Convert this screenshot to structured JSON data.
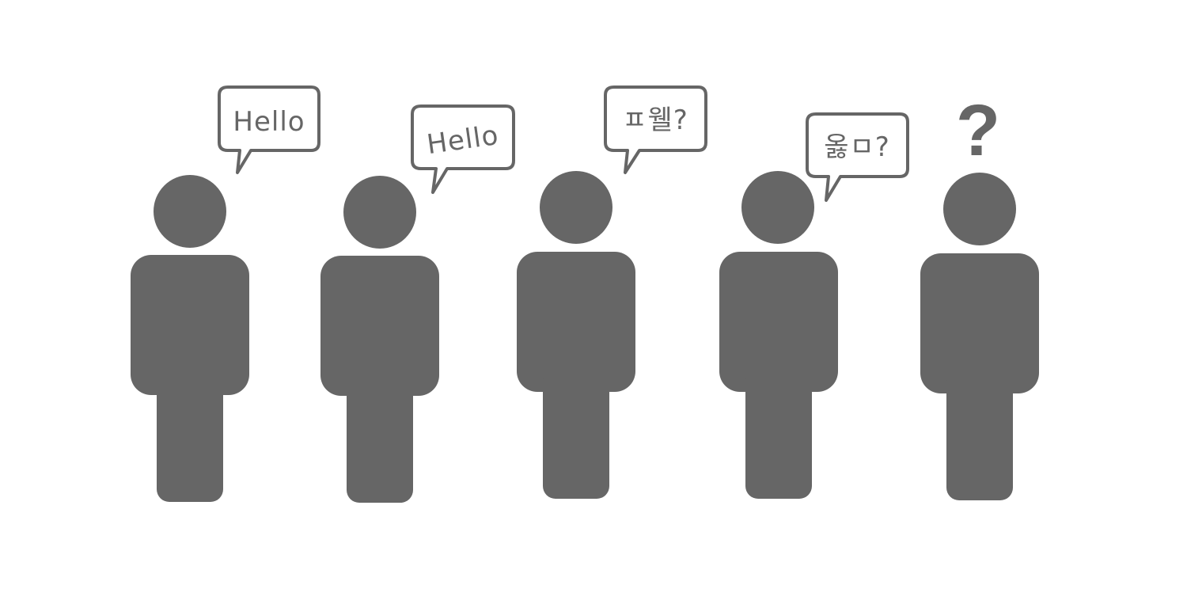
{
  "colors": {
    "figure": "#666666",
    "bubble_stroke": "#666666",
    "bubble_fill": "#ffffff",
    "text": "#666666",
    "background": "#ffffff"
  },
  "people": [
    {
      "speech": "Hello"
    },
    {
      "speech": "Hello"
    },
    {
      "speech": "ㅍ웰?"
    },
    {
      "speech": "옳ㅁ?"
    },
    {
      "speech": "?"
    }
  ]
}
